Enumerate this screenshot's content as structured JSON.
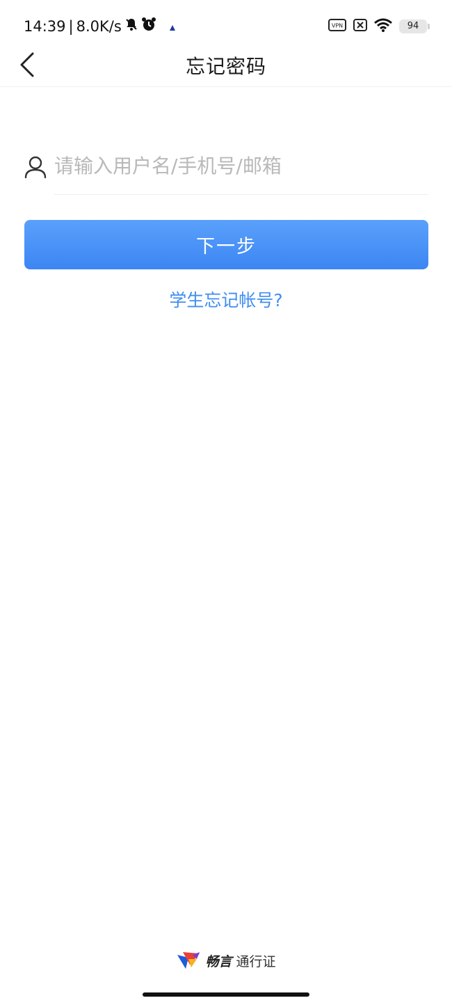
{
  "status_bar": {
    "time": "14:39",
    "separator": "|",
    "net_speed": "8.0K/s",
    "battery_level": "94",
    "icons": [
      "mute-bell-icon",
      "alarm-icon",
      "notification-arrow-icon",
      "vpn-icon",
      "close-box-icon",
      "wifi-icon",
      "battery-icon"
    ]
  },
  "nav": {
    "title": "忘记密码",
    "back_icon": "chevron-left-icon"
  },
  "form": {
    "account_placeholder": "请输入用户名/手机号/邮箱",
    "account_value": "",
    "user_icon": "user-icon",
    "next_label": "下一步",
    "student_link": "学生忘记帐号?"
  },
  "footer": {
    "brand_name": "畅言",
    "brand_sub": "通行证"
  },
  "colors": {
    "accent": "#3f8ef0",
    "button_top": "#5aa0fb",
    "button_bottom": "#3c86f3",
    "placeholder": "#b8b8b8"
  }
}
